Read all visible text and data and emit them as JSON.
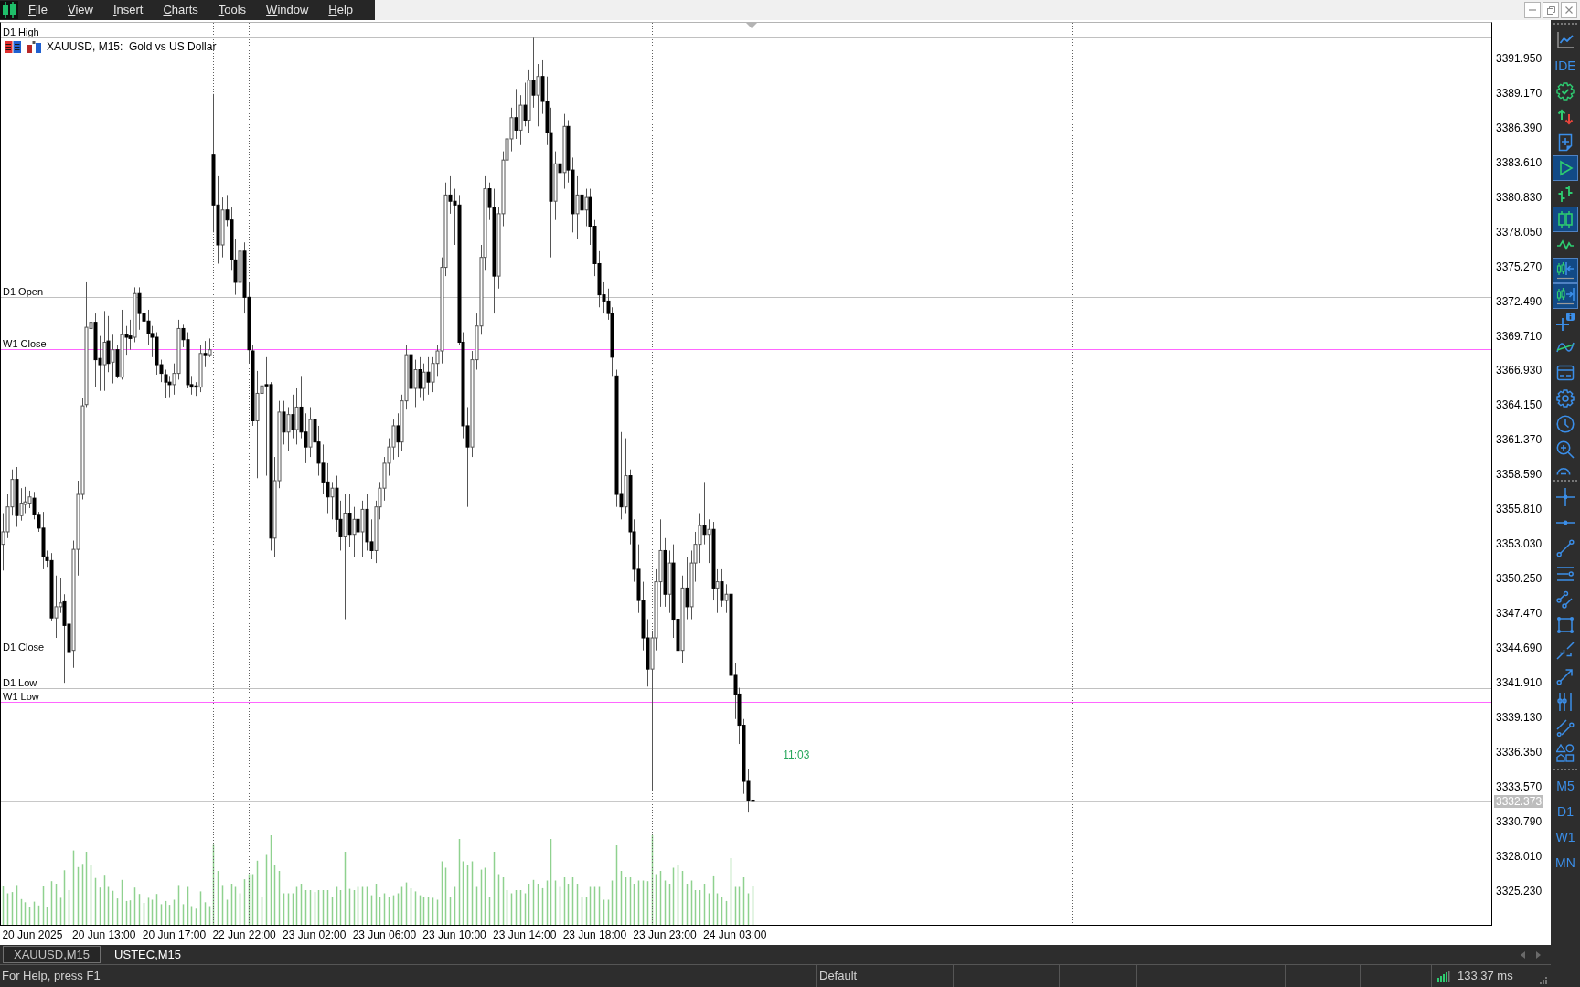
{
  "menu_bar": {
    "items": [
      "File",
      "View",
      "Insert",
      "Charts",
      "Tools",
      "Window",
      "Help"
    ]
  },
  "chart": {
    "title": "XAUUSD, M15:  Gold vs US Dollar",
    "levels": [
      {
        "label": "D1 High",
        "color": "#c0c0c0"
      },
      {
        "label": "D1 Open",
        "color": "#c0c0c0"
      },
      {
        "label": "W1 Close",
        "color": "#ff66ff"
      },
      {
        "label": "D1 Close",
        "color": "#c0c0c0"
      },
      {
        "label": "D1 Low",
        "color": "#c0c0c0"
      },
      {
        "label": "W1 Low",
        "color": "#ff66ff"
      }
    ],
    "bar_timer": "11:03",
    "price_axis": [
      "3391.950",
      "3389.170",
      "3386.390",
      "3383.610",
      "3380.830",
      "3378.050",
      "3375.270",
      "3372.490",
      "3369.710",
      "3366.930",
      "3364.150",
      "3361.370",
      "3358.590",
      "3355.810",
      "3353.030",
      "3350.250",
      "3347.470",
      "3344.690",
      "3341.910",
      "3339.130",
      "3336.350",
      "3333.570",
      "3330.790",
      "3328.010",
      "3325.230"
    ],
    "current_price": "3332.373",
    "time_axis": [
      "20 Jun 2025",
      "20 Jun 13:00",
      "20 Jun 17:00",
      "22 Jun 22:00",
      "23 Jun 02:00",
      "23 Jun 06:00",
      "23 Jun 10:00",
      "23 Jun 14:00",
      "23 Jun 18:00",
      "23 Jun 23:00",
      "24 Jun 03:00"
    ]
  },
  "toolbar": {
    "groups": [
      {
        "items": [
          {
            "kind": "icon",
            "selected": false
          },
          {
            "kind": "text",
            "label": "IDE",
            "selected": false
          },
          {
            "kind": "icon",
            "selected": false
          },
          {
            "kind": "icon",
            "selected": false
          },
          {
            "kind": "icon",
            "selected": false
          },
          {
            "kind": "icon",
            "selected": true
          },
          {
            "kind": "icon",
            "selected": false
          },
          {
            "kind": "icon",
            "selected": true
          },
          {
            "kind": "icon",
            "selected": false
          },
          {
            "kind": "icon",
            "selected": true
          },
          {
            "kind": "icon",
            "selected": true
          },
          {
            "kind": "icon",
            "selected": false
          },
          {
            "kind": "icon",
            "selected": false
          },
          {
            "kind": "icon",
            "selected": false
          },
          {
            "kind": "icon",
            "selected": false
          },
          {
            "kind": "icon",
            "selected": false
          },
          {
            "kind": "icon",
            "selected": false
          },
          {
            "kind": "icon",
            "selected": false
          }
        ]
      },
      {
        "items": [
          {
            "kind": "icon",
            "selected": false
          },
          {
            "kind": "icon",
            "selected": false
          },
          {
            "kind": "icon",
            "selected": false
          },
          {
            "kind": "icon",
            "selected": false
          },
          {
            "kind": "icon",
            "selected": false
          },
          {
            "kind": "icon",
            "selected": false
          },
          {
            "kind": "icon",
            "selected": false
          },
          {
            "kind": "icon",
            "selected": false
          },
          {
            "kind": "icon",
            "selected": false
          },
          {
            "kind": "icon",
            "selected": false
          },
          {
            "kind": "icon",
            "selected": false
          }
        ]
      },
      {
        "items": [
          {
            "kind": "text",
            "label": "M5",
            "selected": false
          },
          {
            "kind": "text",
            "label": "D1",
            "selected": false
          },
          {
            "kind": "text",
            "label": "W1",
            "selected": false
          },
          {
            "kind": "text",
            "label": "MN",
            "selected": false
          }
        ]
      }
    ]
  },
  "chart_tabs": [
    {
      "label": "XAUUSD,M15",
      "selected": true
    },
    {
      "label": "USTEC,M15",
      "selected": false
    }
  ],
  "status_bar": {
    "help": "For Help, press F1",
    "profile": "Default",
    "ping": "133.37 ms"
  }
}
